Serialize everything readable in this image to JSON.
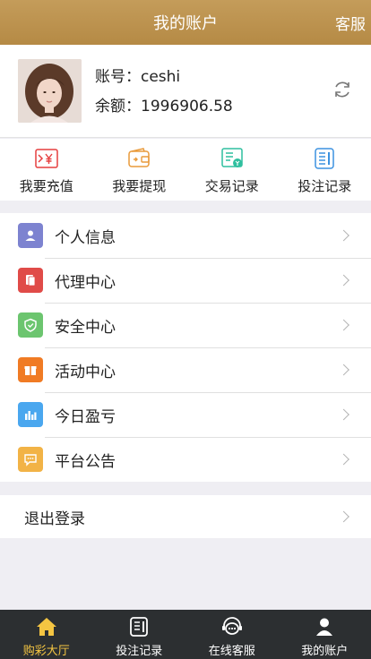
{
  "header": {
    "title": "我的账户",
    "right_label": "客服"
  },
  "profile": {
    "account_label": "账号：ceshi",
    "balance_label": "余额：1996906.58"
  },
  "quick_actions": [
    {
      "label": "我要充值",
      "icon": "recharge-icon",
      "color": "#e63f3f"
    },
    {
      "label": "我要提现",
      "icon": "wallet-icon",
      "color": "#e99a3a"
    },
    {
      "label": "交易记录",
      "icon": "transaction-record-icon",
      "color": "#2fbf9f"
    },
    {
      "label": "投注记录",
      "icon": "bet-record-icon",
      "color": "#3c92e0"
    }
  ],
  "menu": [
    {
      "label": "个人信息",
      "icon": "user-icon",
      "color": "#7d83d0"
    },
    {
      "label": "代理中心",
      "icon": "document-icon",
      "color": "#e04b48"
    },
    {
      "label": "安全中心",
      "icon": "shield-icon",
      "color": "#6cc56f"
    },
    {
      "label": "活动中心",
      "icon": "gift-icon",
      "color": "#f07b24"
    },
    {
      "label": "今日盈亏",
      "icon": "bar-chart-icon",
      "color": "#4aa7ef"
    },
    {
      "label": "平台公告",
      "icon": "message-icon",
      "color": "#f2b346"
    }
  ],
  "logout_label": "退出登录",
  "tabbar": [
    {
      "label": "购彩大厅",
      "icon": "home-icon",
      "active": true
    },
    {
      "label": "投注记录",
      "icon": "bet-record-icon",
      "active": false
    },
    {
      "label": "在线客服",
      "icon": "customer-service-icon",
      "active": false
    },
    {
      "label": "我的账户",
      "icon": "account-icon",
      "active": false
    }
  ],
  "colors": {
    "header": "#b58a45",
    "tab_active": "#f4c542",
    "tabbar_bg": "#2c2f31"
  }
}
